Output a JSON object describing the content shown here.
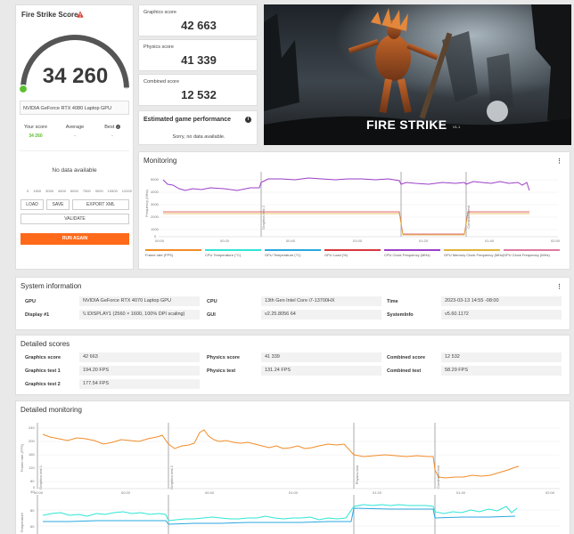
{
  "score_card": {
    "title": "Fire Strike Score",
    "score": "34 260",
    "gpu": "NVIDIA GeForce RTX 4080 Laptop GPU",
    "your_score_label": "Your score",
    "your_score": "34 260",
    "average_label": "Average",
    "average": "-",
    "best_label": "Best",
    "best": "-",
    "no_data": "No data available",
    "ticks": [
      "0",
      "1500",
      "3000",
      "4500",
      "6000",
      "7500",
      "9000",
      "10500",
      "12000"
    ],
    "load_label": "LOAD",
    "save_label": "SAVE",
    "export_label": "EXPORT XML",
    "validate_label": "VALIDATE",
    "run_label": "RUN AGAIN",
    "gauge_fraction": 0.99
  },
  "subscores": {
    "graphics_label": "Graphics score",
    "graphics": "42 663",
    "physics_label": "Physics score",
    "physics": "41 339",
    "combined_label": "Combined score",
    "combined": "12 532"
  },
  "estimated": {
    "title": "Estimated game performance",
    "message": "Sorry, no data available."
  },
  "hero": {
    "title": "FIRE STRIKE",
    "version": "V1.1"
  },
  "monitoring": {
    "title": "Monitoring",
    "y_label": "Frequency (MHz)",
    "y_ticks": [
      "5000",
      "4000",
      "3000",
      "2000",
      "1000",
      "0"
    ],
    "x_ticks": [
      "00:00",
      "00:20",
      "00:40",
      "01:00",
      "01:20",
      "01:40",
      "02:00"
    ],
    "markers": [
      "Graphics test 1",
      "Graphics test 2",
      "Physics test",
      "Combined test"
    ],
    "legend": [
      {
        "label": "Frame rate (FPS)",
        "color": "#f28c28"
      },
      {
        "label": "CPU Temperature (°C)",
        "color": "#2ee6d6"
      },
      {
        "label": "GPU Temperature (°C)",
        "color": "#2aa7e0"
      },
      {
        "label": "GPU Load (%)",
        "color": "#d9363e"
      },
      {
        "label": "CPU Clock Frequency (MHz)",
        "color": "#9b3fc8"
      },
      {
        "label": "GPU Memory Clock Frequency (MHz)",
        "color": "#e0b43c"
      },
      {
        "label": "GPU Clock Frequency (MHz)",
        "color": "#e07aa3"
      }
    ]
  },
  "system_info": {
    "title": "System information",
    "gpu_label": "GPU",
    "gpu": "NVIDIA GeForce RTX 4070 Laptop GPU",
    "display_label": "Display #1",
    "display": "\\\\.\\DISPLAY1 (2560 × 1600, 100% DPI scaling)",
    "cpu_label": "CPU",
    "cpu": "13th Gen Intel Core i7-13700HX",
    "gui_label": "GUI",
    "gui": "v2.25.8056 64",
    "time_label": "Time",
    "time": "2023-03-13 14:55 -08:00",
    "sysinfo_label": "SystemInfo",
    "sysinfo": "v5.60.1172"
  },
  "detailed_scores": {
    "title": "Detailed scores",
    "graphics_score_label": "Graphics score",
    "graphics_score": "42 663",
    "graphics_test1_label": "Graphics test 1",
    "graphics_test1": "194.20 FPS",
    "graphics_test2_label": "Graphics test 2",
    "graphics_test2": "177.54 FPS",
    "physics_score_label": "Physics score",
    "physics_score": "41 339",
    "physics_test_label": "Physics test",
    "physics_test": "131.24 FPS",
    "combined_score_label": "Combined score",
    "combined_score": "12 532",
    "combined_test_label": "Combined test",
    "combined_test": "58.29 FPS"
  },
  "detailed_monitoring": {
    "title": "Detailed monitoring",
    "y_label": "Frame rate (FPS)",
    "y2_label": "Temperature",
    "y_ticks": [
      "240",
      "200",
      "160",
      "120",
      "80",
      "40",
      "0"
    ],
    "y2_ticks": [
      "80",
      "60"
    ],
    "x_ticks": [
      "00:00",
      "00:20",
      "00:40",
      "01:00",
      "01:20",
      "01:40",
      "02:00"
    ],
    "markers": [
      "Graphics test 1",
      "Graphics test 2",
      "Physics test",
      "Combined test"
    ]
  }
}
